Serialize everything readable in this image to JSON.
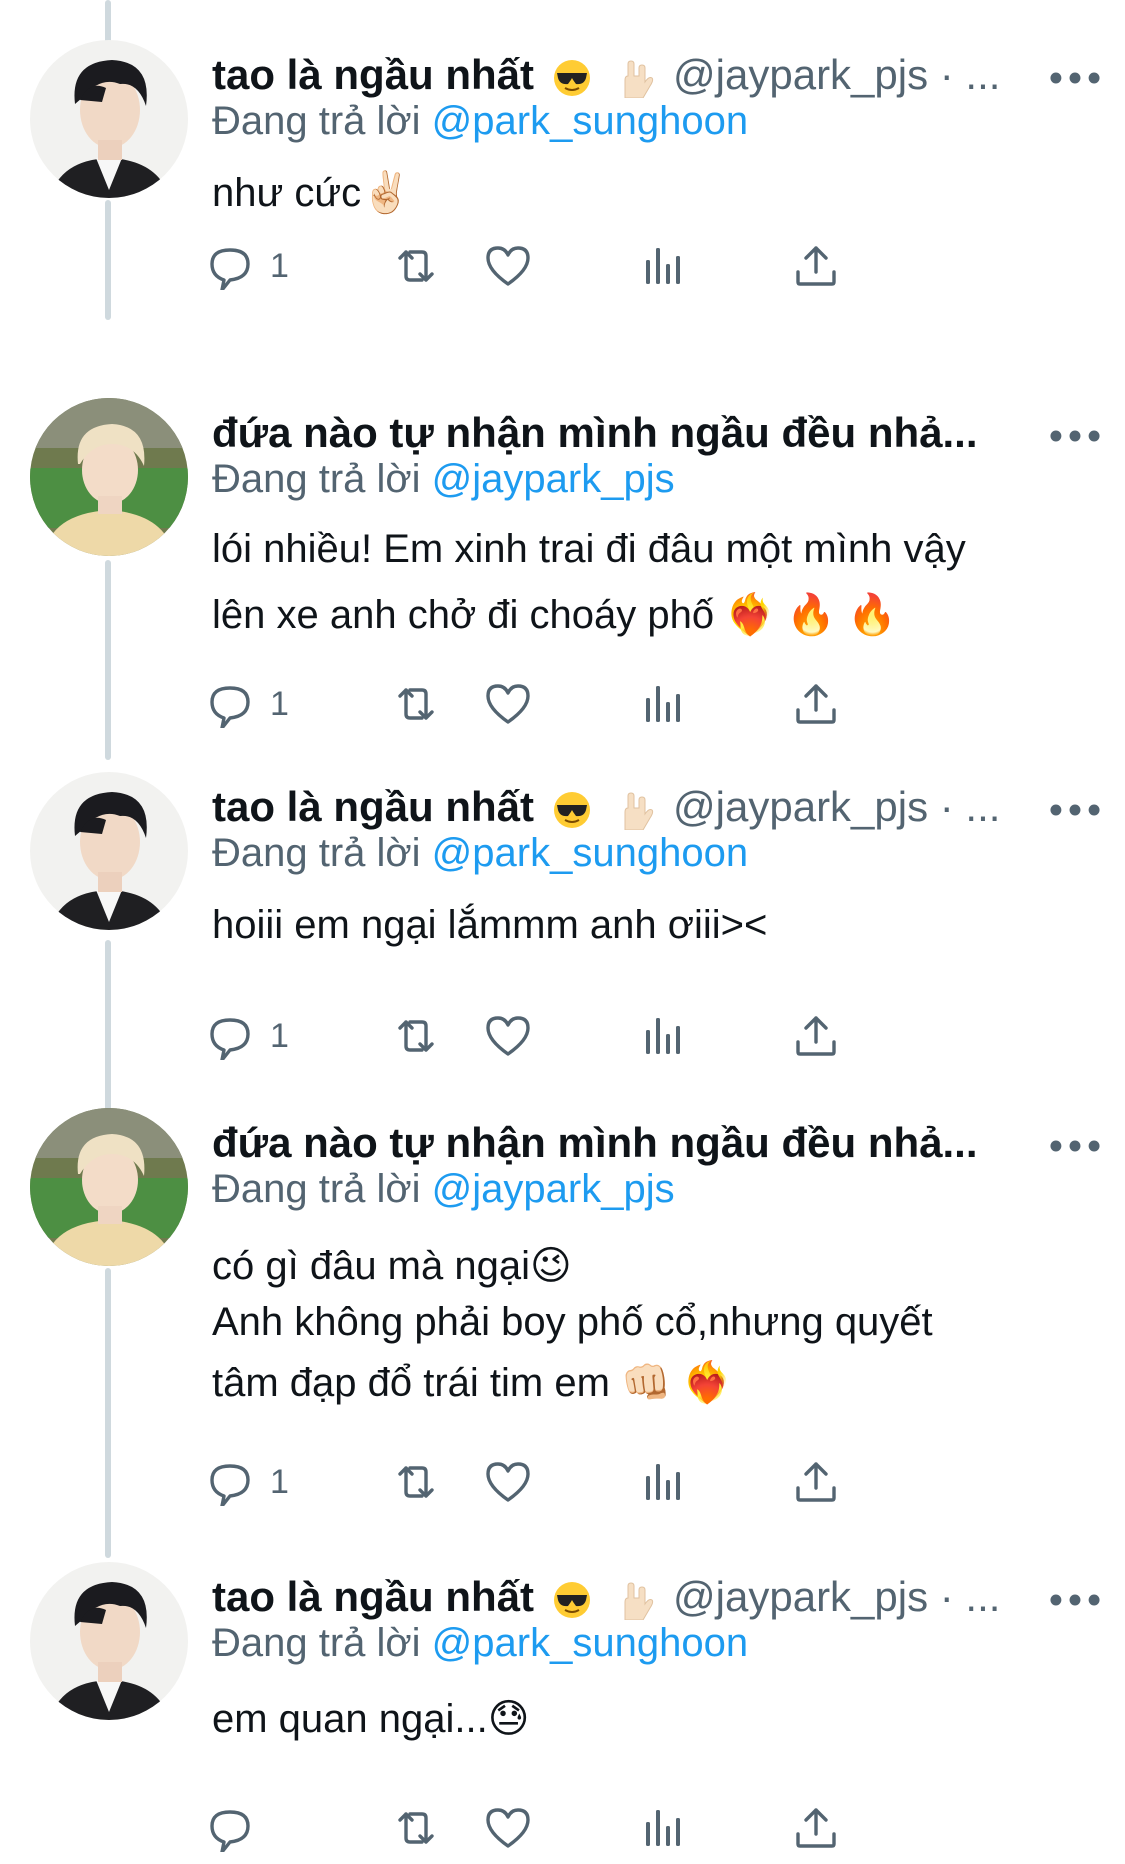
{
  "tweets": [
    {
      "name": "tao là ngầu nhất",
      "handle": "@jaypark_pjs · ...",
      "reply_prefix": "Đang trả lời",
      "reply_mention": "@park_sunghoon",
      "lines": [
        "như cức✌🏻"
      ],
      "reply_count": "1"
    },
    {
      "name": "đứa nào tự nhận mình ngầu đều nhả...",
      "handle": "",
      "reply_prefix": "Đang trả lời",
      "reply_mention": "@jaypark_pjs",
      "lines": [
        "lói nhiều! Em xinh trai đi đâu một mình vậy",
        "lên xe anh chở đi choáy phố ❤️‍🔥 🔥 🔥"
      ],
      "reply_count": "1"
    },
    {
      "name": "tao là ngầu nhất",
      "handle": "@jaypark_pjs · ...",
      "reply_prefix": "Đang trả lời",
      "reply_mention": "@park_sunghoon",
      "lines": [
        "hoiii em ngại lắmmm anh ơiii><"
      ],
      "reply_count": "1"
    },
    {
      "name": "đứa nào tự nhận mình ngầu đều nhả...",
      "handle": "",
      "reply_prefix": "Đang trả lời",
      "reply_mention": "@jaypark_pjs",
      "lines": [
        "có gì đâu mà ngại😉",
        "Anh không phải boy phố cổ,nhưng quyết",
        "tâm đạp đổ trái tim em 👊🏻 ❤️‍🔥"
      ],
      "reply_count": "1"
    },
    {
      "name": "tao là ngầu nhất",
      "handle": "@jaypark_pjs · ...",
      "reply_prefix": "Đang trả lời",
      "reply_mention": "@park_sunghoon",
      "lines": [
        "em quan ngại...😓"
      ],
      "reply_count": ""
    }
  ],
  "icons": {
    "reply": "reply-icon",
    "retweet": "retweet-icon",
    "like": "heart-icon",
    "views": "views-icon",
    "share": "share-icon",
    "more": "more-icon"
  },
  "colors": {
    "link": "#1d9bf0",
    "muted": "#536471",
    "thread_line": "#cfd9de"
  }
}
